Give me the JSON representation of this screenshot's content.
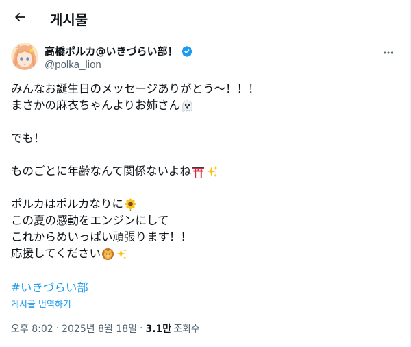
{
  "header": {
    "title": "게시물",
    "back_icon": "arrow-left-icon"
  },
  "author": {
    "display_name": "高橋ポルカ@いきづらい部！",
    "handle": "@polka_lion",
    "verified": true,
    "verified_color": "#1d9bf0"
  },
  "tweet": {
    "lines": [
      {
        "text": "みんなお誕生日のメッセージありがとう〜！！！",
        "emoji": ""
      },
      {
        "text": "まさかの麻衣ちゃんよりお姉さん",
        "emoji": "ghost"
      },
      {
        "text": "",
        "emoji": ""
      },
      {
        "text": "でも！",
        "emoji": ""
      },
      {
        "text": "",
        "emoji": ""
      },
      {
        "text": "ものごとに年齢なんて関係ないよね",
        "emoji": "torii,sparkles"
      },
      {
        "text": "",
        "emoji": ""
      },
      {
        "text": "ポルカはポルカなりに",
        "emoji": "sunflower"
      },
      {
        "text": "この夏の感動をエンジンにして",
        "emoji": ""
      },
      {
        "text": "これからめいっぱい頑張ります！！",
        "emoji": ""
      },
      {
        "text": "応援してください",
        "emoji": "lion,sparkles"
      }
    ],
    "hashtag": "#いきづらい部",
    "translate_label": "게시물 번역하기"
  },
  "meta": {
    "time": "오후 8:02",
    "separator": "·",
    "date": "2025년 8월 18일",
    "views_count": "3.1만",
    "views_label": "조회수"
  },
  "colors": {
    "accent": "#1d9bf0",
    "secondary_text": "#536471",
    "primary_text": "#0f1419"
  }
}
